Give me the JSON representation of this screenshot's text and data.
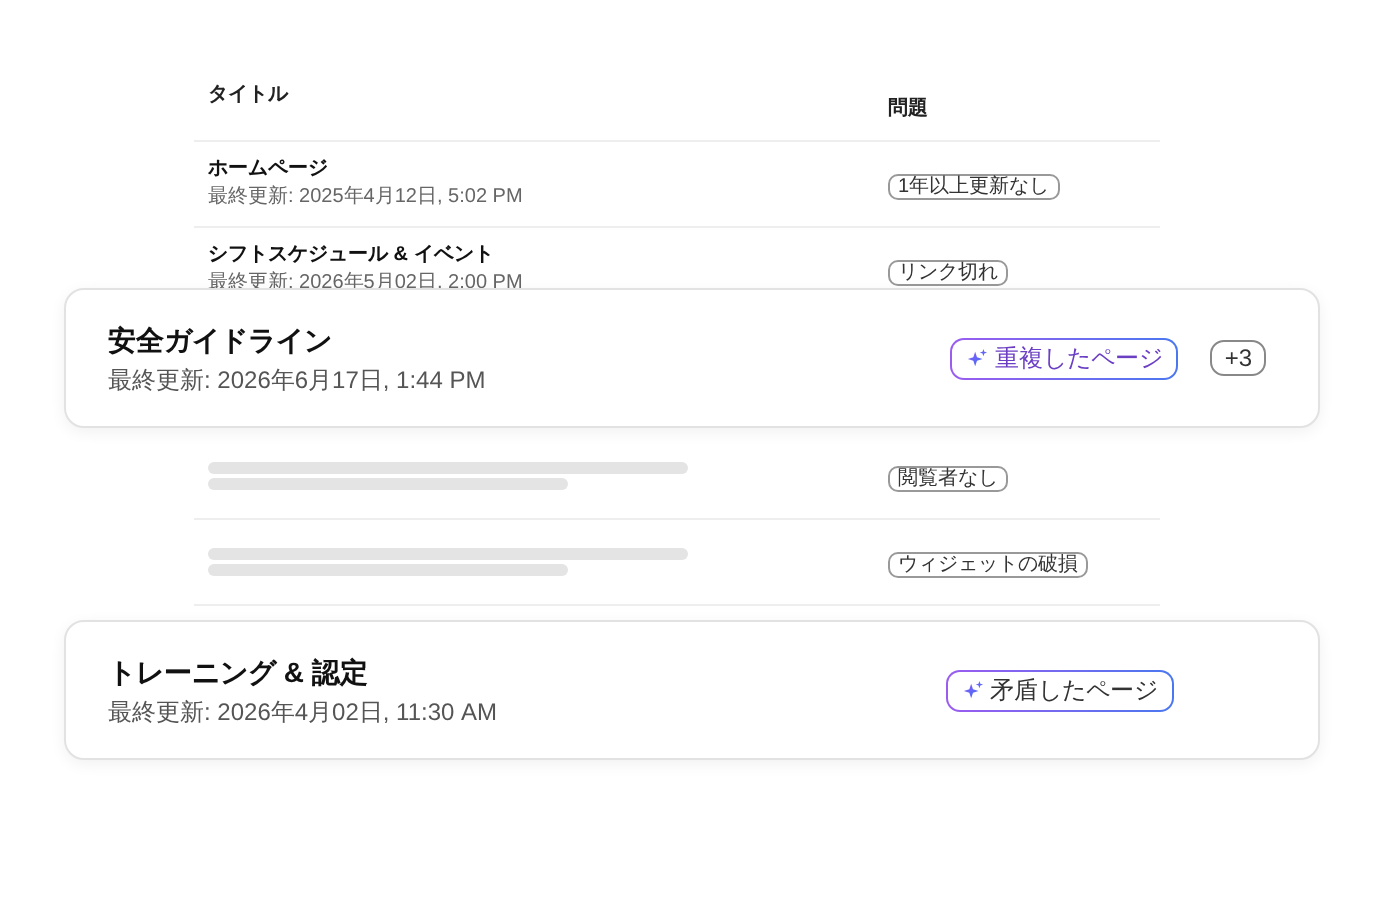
{
  "table": {
    "columns": [
      "タイトル",
      "問題"
    ],
    "rows": [
      {
        "kind": "text",
        "title": "ホームページ",
        "updated": "最終更新: 2025年4月12日, 5:02 PM",
        "issue": "1年以上更新なし"
      },
      {
        "kind": "text",
        "title": "シフトスケジュール & イベント",
        "updated": "最終更新: 2026年5月02日, 2:00 PM",
        "issue": "リンク切れ"
      },
      {
        "kind": "skeleton",
        "issue": "閲覧者なし"
      },
      {
        "kind": "skeleton",
        "issue": "ウィジェットの破損"
      }
    ]
  },
  "cards": [
    {
      "title": "安全ガイドライン",
      "updated": "最終更新: 2026年6月17日, 1:44 PM",
      "tag": "重複したページ",
      "more": "+3"
    },
    {
      "title": "トレーニング & 認定",
      "updated": "最終更新: 2026年4月02日, 11:30 AM",
      "tag": "矛盾したページ"
    }
  ]
}
